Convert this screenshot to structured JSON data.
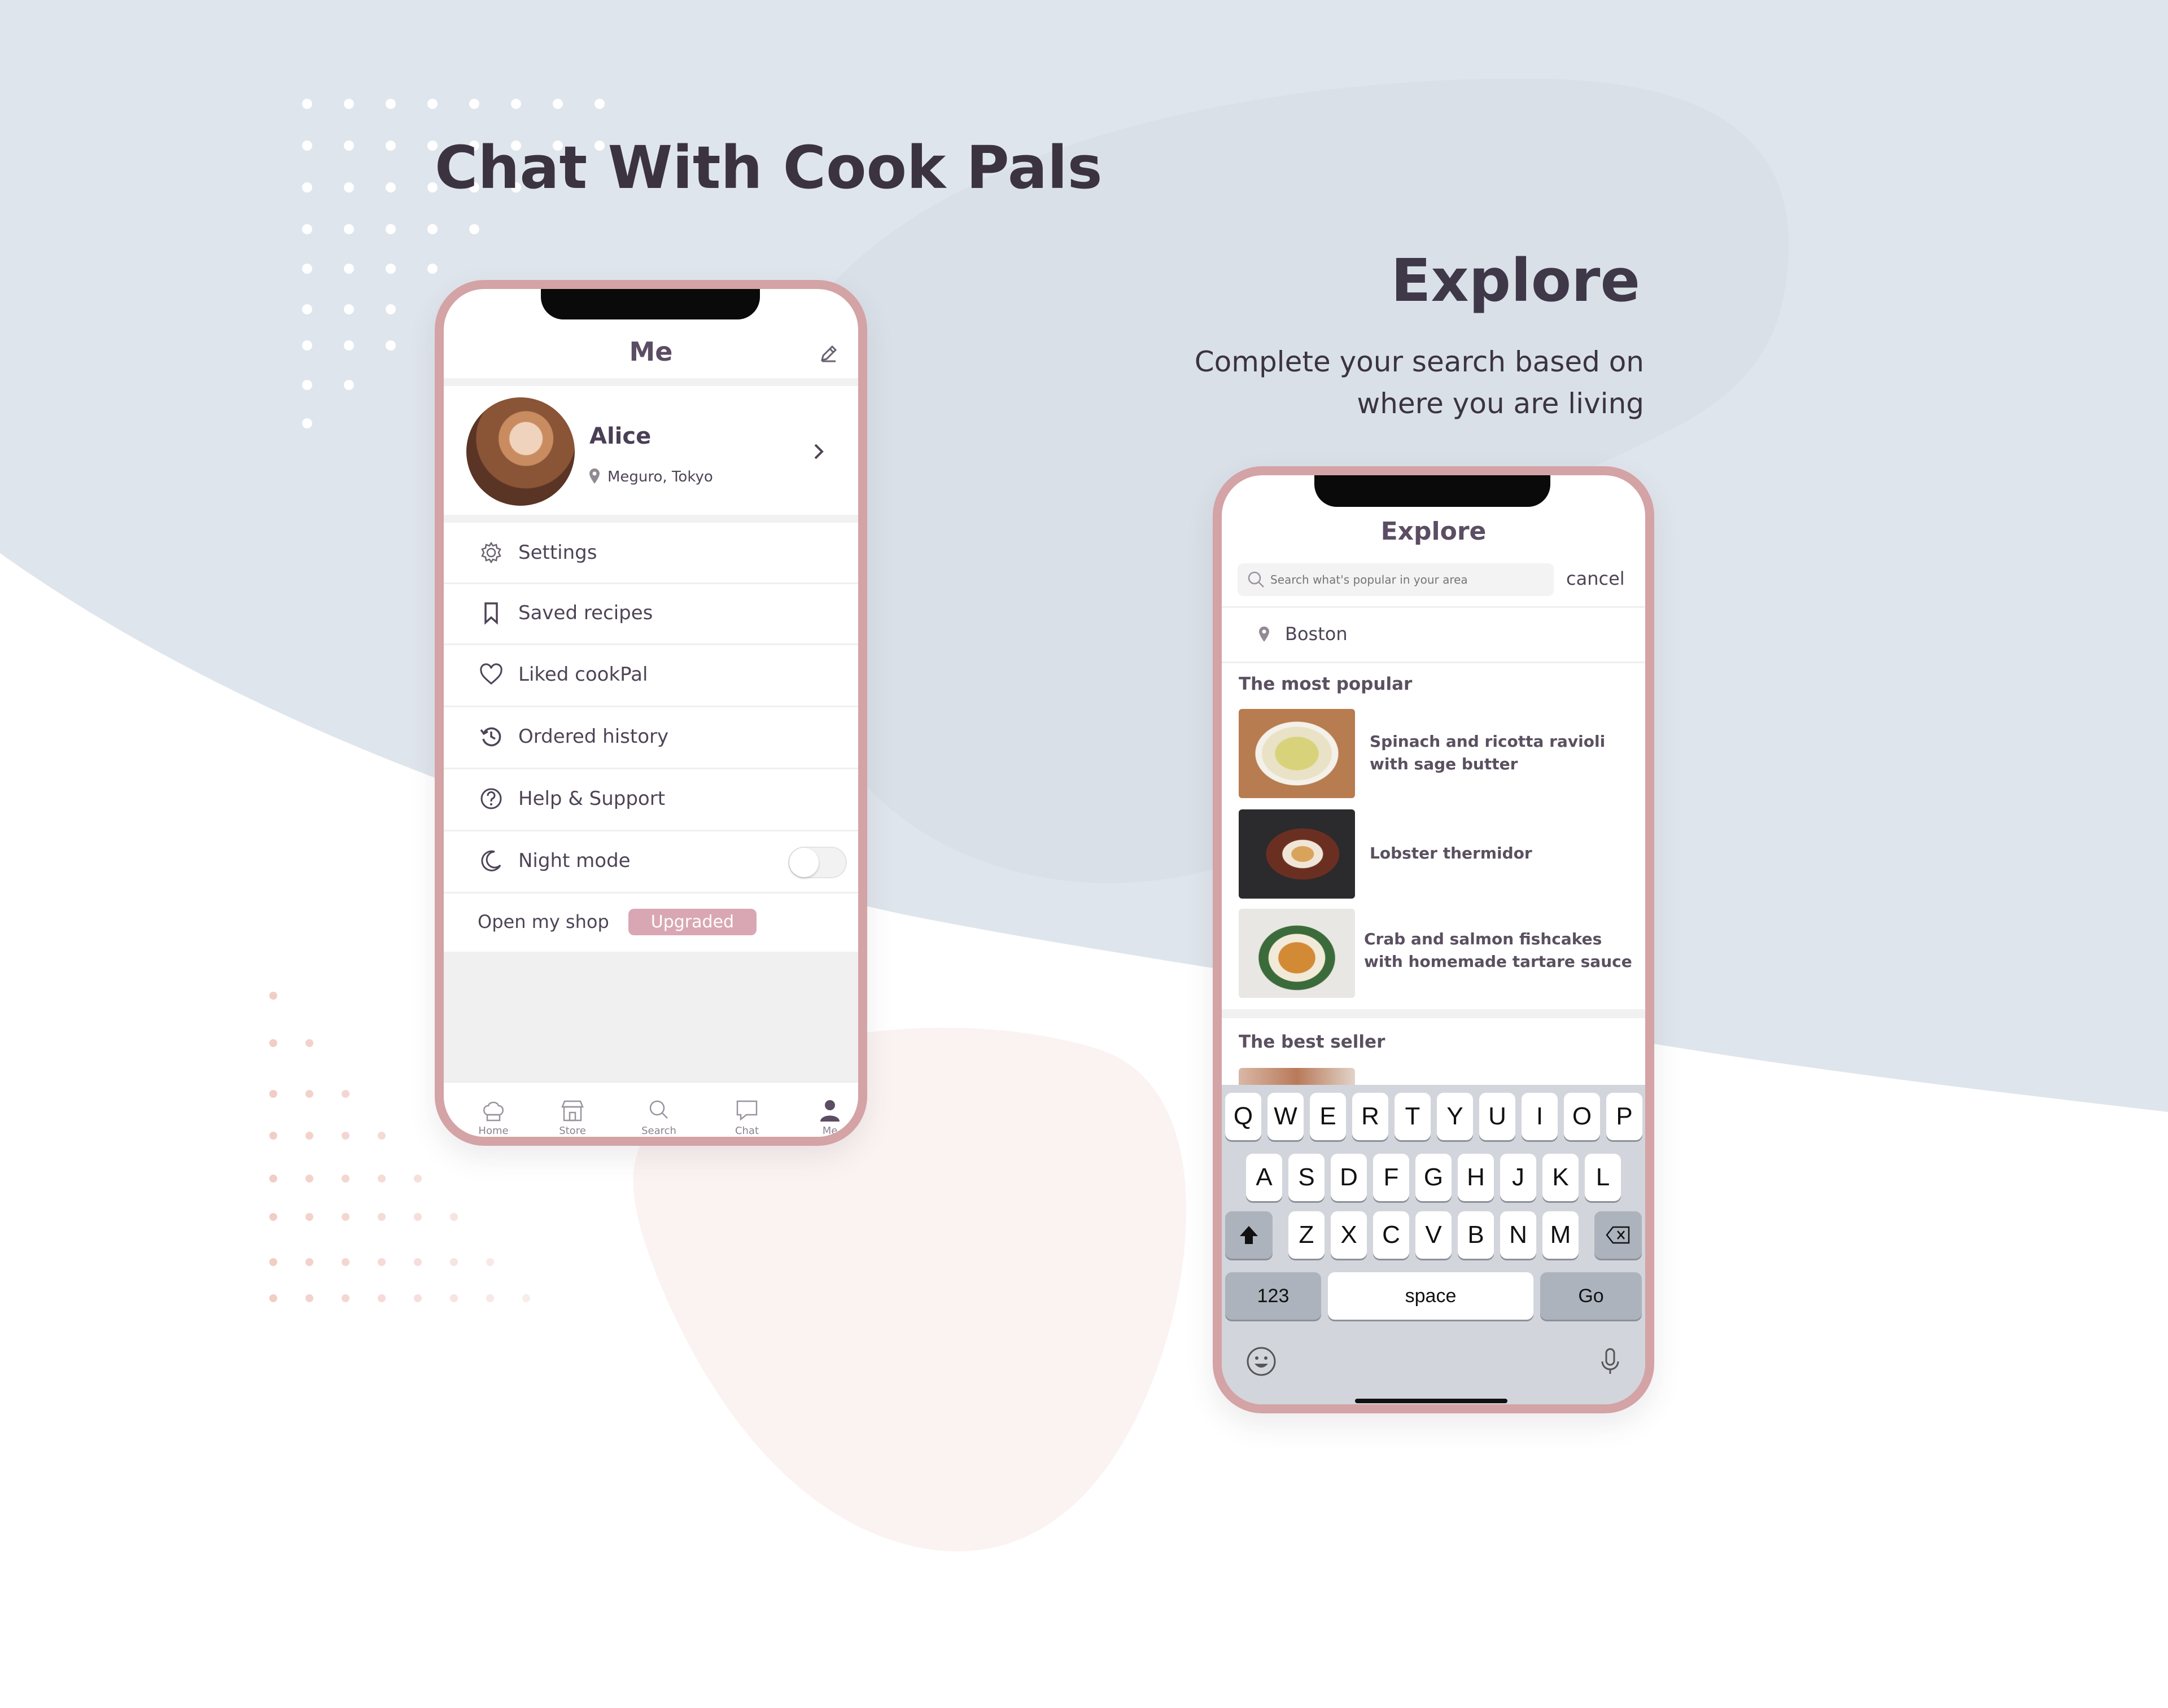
{
  "page": {
    "title": "Chat With Cook Pals",
    "explore_title": "Explore",
    "explore_subtitle_line1": "Complete your search based on",
    "explore_subtitle_line2": "where you are living"
  },
  "me_screen": {
    "title": "Me",
    "edit_icon": "pencil-icon",
    "profile": {
      "name": "Alice",
      "location": "Meguro, Tokyo"
    },
    "menu": [
      {
        "label": "Settings",
        "icon": "gear-icon"
      },
      {
        "label": "Saved recipes",
        "icon": "bookmark-icon"
      },
      {
        "label": "Liked cookPal",
        "icon": "heart-icon"
      },
      {
        "label": "Ordered history",
        "icon": "history-icon"
      },
      {
        "label": "Help & Support",
        "icon": "question-circle-icon"
      },
      {
        "label": "Night mode",
        "icon": "moon-icon"
      }
    ],
    "night_mode_on": false,
    "shop": {
      "label": "Open my shop",
      "badge": "Upgraded"
    },
    "tabbar": [
      {
        "label": "Home",
        "icon": "chef-hat-icon"
      },
      {
        "label": "Store",
        "icon": "store-icon"
      },
      {
        "label": "Search",
        "icon": "search-icon"
      },
      {
        "label": "Chat",
        "icon": "chat-icon"
      },
      {
        "label": "Me",
        "icon": "user-icon"
      }
    ]
  },
  "explore_screen": {
    "title": "Explore",
    "search_placeholder": "Search what's popular in your area",
    "cancel_label": "cancel",
    "location": "Boston",
    "most_popular_heading": "The most popular",
    "items": [
      {
        "title_line1": "Spinach and ricotta ravioli",
        "title_line2": "with sage butter"
      },
      {
        "title_line1": "Lobster thermidor",
        "title_line2": ""
      },
      {
        "title_line1": "Crab and salmon fishcakes",
        "title_line2": "with homemade tartare sauce"
      }
    ],
    "best_seller_heading": "The best seller"
  },
  "keyboard": {
    "row1": [
      "Q",
      "W",
      "E",
      "R",
      "T",
      "Y",
      "U",
      "I",
      "O",
      "P"
    ],
    "row2": [
      "A",
      "S",
      "D",
      "F",
      "G",
      "H",
      "J",
      "K",
      "L"
    ],
    "row3": [
      "Z",
      "X",
      "C",
      "V",
      "B",
      "N",
      "M"
    ],
    "numbers_key": "123",
    "space_key": "space",
    "go_key": "Go"
  },
  "colors": {
    "accent_pink": "#d4a3a5",
    "badge_pink": "#d9a7b3",
    "text_dark": "#3b3340",
    "bg_blue": "#dfe5ec"
  }
}
